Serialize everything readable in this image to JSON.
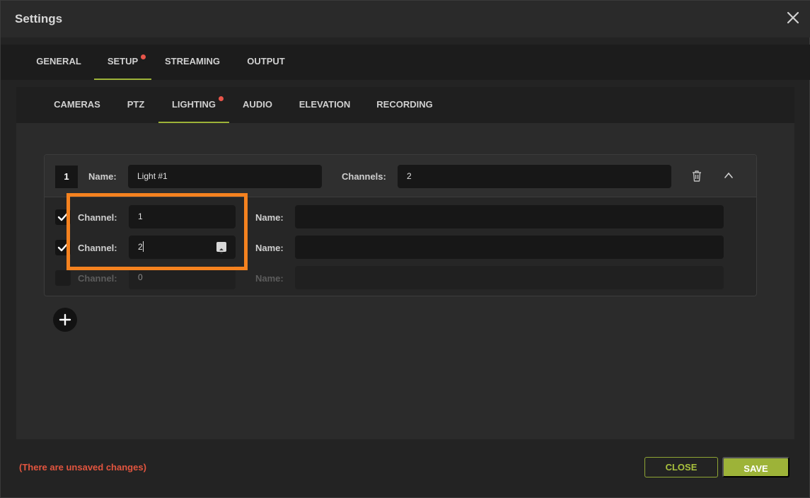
{
  "dialog": {
    "title": "Settings",
    "close_icon": "close-icon"
  },
  "main_tabs": [
    {
      "label": "GENERAL",
      "active": false,
      "has_dot": false
    },
    {
      "label": "SETUP",
      "active": true,
      "has_dot": true
    },
    {
      "label": "STREAMING",
      "active": false,
      "has_dot": false
    },
    {
      "label": "OUTPUT",
      "active": false,
      "has_dot": false
    }
  ],
  "sub_tabs": [
    {
      "label": "CAMERAS",
      "active": false,
      "has_dot": false
    },
    {
      "label": "PTZ",
      "active": false,
      "has_dot": false
    },
    {
      "label": "LIGHTING",
      "active": true,
      "has_dot": true
    },
    {
      "label": "AUDIO",
      "active": false,
      "has_dot": false
    },
    {
      "label": "ELEVATION",
      "active": false,
      "has_dot": false
    },
    {
      "label": "RECORDING",
      "active": false,
      "has_dot": false
    }
  ],
  "light": {
    "number": "1",
    "name_label": "Name:",
    "name_value": "Light #1",
    "channels_label": "Channels:",
    "channels_value": "2",
    "delete_icon": "trash-icon",
    "collapse_icon": "chevron-up-icon",
    "rows": [
      {
        "checked": true,
        "enabled": true,
        "channel_label": "Channel:",
        "channel_value": "1",
        "name_label": "Name:",
        "name_value": ""
      },
      {
        "checked": true,
        "enabled": true,
        "channel_label": "Channel:",
        "channel_value": "2",
        "name_label": "Name:",
        "name_value": ""
      },
      {
        "checked": false,
        "enabled": false,
        "channel_label": "Channel:",
        "channel_value": "0",
        "name_label": "Name:",
        "name_value": ""
      }
    ]
  },
  "add_icon": "plus-icon",
  "footer": {
    "unsaved_text": "(There are unsaved changes)",
    "close_label": "CLOSE",
    "save_label": "SAVE"
  },
  "colors": {
    "accent": "#9db338",
    "alert": "#e8554a",
    "highlight": "#f5821f"
  }
}
